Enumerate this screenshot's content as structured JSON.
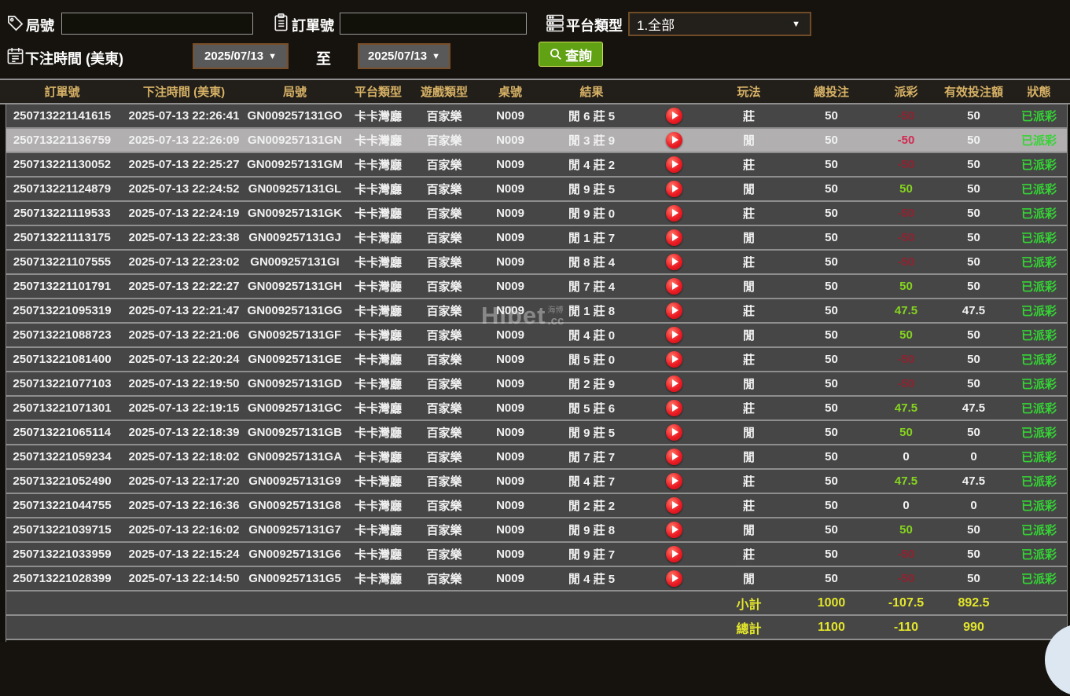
{
  "filters": {
    "round_label": "局號",
    "round_value": "",
    "order_label": "訂單號",
    "order_value": "",
    "platform_label": "平台類型",
    "platform_value": "1.全部",
    "bet_time_label": "下注時間 (美東)",
    "date_from": "2025/07/13",
    "to_label": "至",
    "date_to": "2025/07/13",
    "query_label": "查詢"
  },
  "icons": {
    "round": "tag-icon",
    "order": "clipboard-icon",
    "platform": "server-icon",
    "bet_time": "calendar-icon",
    "query": "search-icon",
    "row_action": "play-icon"
  },
  "table": {
    "columns": [
      "訂單號",
      "下注時間 (美東)",
      "局號",
      "平台類型",
      "遊戲類型",
      "桌號",
      "結果",
      "玩法",
      "總投注",
      "派彩",
      "有效投注額",
      "狀態"
    ],
    "rows": [
      {
        "order": "250713221141615",
        "time": "2025-07-13 22:26:41",
        "round": "GN009257131GO",
        "platform": "卡卡灣廳",
        "game": "百家樂",
        "table_no": "N009",
        "result": "閒 6 莊 5",
        "play": "莊",
        "total_bet": "50",
        "payout": "-50",
        "valid_bet": "50",
        "status": "已派彩",
        "highlighted": false
      },
      {
        "order": "250713221136759",
        "time": "2025-07-13 22:26:09",
        "round": "GN009257131GN",
        "platform": "卡卡灣廳",
        "game": "百家樂",
        "table_no": "N009",
        "result": "閒 3 莊 9",
        "play": "閒",
        "total_bet": "50",
        "payout": "-50",
        "valid_bet": "50",
        "status": "已派彩",
        "highlighted": true
      },
      {
        "order": "250713221130052",
        "time": "2025-07-13 22:25:27",
        "round": "GN009257131GM",
        "platform": "卡卡灣廳",
        "game": "百家樂",
        "table_no": "N009",
        "result": "閒 4 莊 2",
        "play": "莊",
        "total_bet": "50",
        "payout": "-50",
        "valid_bet": "50",
        "status": "已派彩",
        "highlighted": false
      },
      {
        "order": "250713221124879",
        "time": "2025-07-13 22:24:52",
        "round": "GN009257131GL",
        "platform": "卡卡灣廳",
        "game": "百家樂",
        "table_no": "N009",
        "result": "閒 9 莊 5",
        "play": "閒",
        "total_bet": "50",
        "payout": "50",
        "valid_bet": "50",
        "status": "已派彩",
        "highlighted": false
      },
      {
        "order": "250713221119533",
        "time": "2025-07-13 22:24:19",
        "round": "GN009257131GK",
        "platform": "卡卡灣廳",
        "game": "百家樂",
        "table_no": "N009",
        "result": "閒 9 莊 0",
        "play": "莊",
        "total_bet": "50",
        "payout": "-50",
        "valid_bet": "50",
        "status": "已派彩",
        "highlighted": false
      },
      {
        "order": "250713221113175",
        "time": "2025-07-13 22:23:38",
        "round": "GN009257131GJ",
        "platform": "卡卡灣廳",
        "game": "百家樂",
        "table_no": "N009",
        "result": "閒 1 莊 7",
        "play": "閒",
        "total_bet": "50",
        "payout": "-50",
        "valid_bet": "50",
        "status": "已派彩",
        "highlighted": false
      },
      {
        "order": "250713221107555",
        "time": "2025-07-13 22:23:02",
        "round": "GN009257131GI",
        "platform": "卡卡灣廳",
        "game": "百家樂",
        "table_no": "N009",
        "result": "閒 8 莊 4",
        "play": "莊",
        "total_bet": "50",
        "payout": "-50",
        "valid_bet": "50",
        "status": "已派彩",
        "highlighted": false
      },
      {
        "order": "250713221101791",
        "time": "2025-07-13 22:22:27",
        "round": "GN009257131GH",
        "platform": "卡卡灣廳",
        "game": "百家樂",
        "table_no": "N009",
        "result": "閒 7 莊 4",
        "play": "閒",
        "total_bet": "50",
        "payout": "50",
        "valid_bet": "50",
        "status": "已派彩",
        "highlighted": false
      },
      {
        "order": "250713221095319",
        "time": "2025-07-13 22:21:47",
        "round": "GN009257131GG",
        "platform": "卡卡灣廳",
        "game": "百家樂",
        "table_no": "N009",
        "result": "閒 1 莊 8",
        "play": "莊",
        "total_bet": "50",
        "payout": "47.5",
        "valid_bet": "47.5",
        "status": "已派彩",
        "highlighted": false
      },
      {
        "order": "250713221088723",
        "time": "2025-07-13 22:21:06",
        "round": "GN009257131GF",
        "platform": "卡卡灣廳",
        "game": "百家樂",
        "table_no": "N009",
        "result": "閒 4 莊 0",
        "play": "閒",
        "total_bet": "50",
        "payout": "50",
        "valid_bet": "50",
        "status": "已派彩",
        "highlighted": false
      },
      {
        "order": "250713221081400",
        "time": "2025-07-13 22:20:24",
        "round": "GN009257131GE",
        "platform": "卡卡灣廳",
        "game": "百家樂",
        "table_no": "N009",
        "result": "閒 5 莊 0",
        "play": "莊",
        "total_bet": "50",
        "payout": "-50",
        "valid_bet": "50",
        "status": "已派彩",
        "highlighted": false
      },
      {
        "order": "250713221077103",
        "time": "2025-07-13 22:19:50",
        "round": "GN009257131GD",
        "platform": "卡卡灣廳",
        "game": "百家樂",
        "table_no": "N009",
        "result": "閒 2 莊 9",
        "play": "閒",
        "total_bet": "50",
        "payout": "-50",
        "valid_bet": "50",
        "status": "已派彩",
        "highlighted": false
      },
      {
        "order": "250713221071301",
        "time": "2025-07-13 22:19:15",
        "round": "GN009257131GC",
        "platform": "卡卡灣廳",
        "game": "百家樂",
        "table_no": "N009",
        "result": "閒 5 莊 6",
        "play": "莊",
        "total_bet": "50",
        "payout": "47.5",
        "valid_bet": "47.5",
        "status": "已派彩",
        "highlighted": false
      },
      {
        "order": "250713221065114",
        "time": "2025-07-13 22:18:39",
        "round": "GN009257131GB",
        "platform": "卡卡灣廳",
        "game": "百家樂",
        "table_no": "N009",
        "result": "閒 9 莊 5",
        "play": "閒",
        "total_bet": "50",
        "payout": "50",
        "valid_bet": "50",
        "status": "已派彩",
        "highlighted": false
      },
      {
        "order": "250713221059234",
        "time": "2025-07-13 22:18:02",
        "round": "GN009257131GA",
        "platform": "卡卡灣廳",
        "game": "百家樂",
        "table_no": "N009",
        "result": "閒 7 莊 7",
        "play": "閒",
        "total_bet": "50",
        "payout": "0",
        "valid_bet": "0",
        "status": "已派彩",
        "highlighted": false
      },
      {
        "order": "250713221052490",
        "time": "2025-07-13 22:17:20",
        "round": "GN009257131G9",
        "platform": "卡卡灣廳",
        "game": "百家樂",
        "table_no": "N009",
        "result": "閒 4 莊 7",
        "play": "莊",
        "total_bet": "50",
        "payout": "47.5",
        "valid_bet": "47.5",
        "status": "已派彩",
        "highlighted": false
      },
      {
        "order": "250713221044755",
        "time": "2025-07-13 22:16:36",
        "round": "GN009257131G8",
        "platform": "卡卡灣廳",
        "game": "百家樂",
        "table_no": "N009",
        "result": "閒 2 莊 2",
        "play": "莊",
        "total_bet": "50",
        "payout": "0",
        "valid_bet": "0",
        "status": "已派彩",
        "highlighted": false
      },
      {
        "order": "250713221039715",
        "time": "2025-07-13 22:16:02",
        "round": "GN009257131G7",
        "platform": "卡卡灣廳",
        "game": "百家樂",
        "table_no": "N009",
        "result": "閒 9 莊 8",
        "play": "閒",
        "total_bet": "50",
        "payout": "50",
        "valid_bet": "50",
        "status": "已派彩",
        "highlighted": false
      },
      {
        "order": "250713221033959",
        "time": "2025-07-13 22:15:24",
        "round": "GN009257131G6",
        "platform": "卡卡灣廳",
        "game": "百家樂",
        "table_no": "N009",
        "result": "閒 9 莊 7",
        "play": "莊",
        "total_bet": "50",
        "payout": "-50",
        "valid_bet": "50",
        "status": "已派彩",
        "highlighted": false
      },
      {
        "order": "250713221028399",
        "time": "2025-07-13 22:14:50",
        "round": "GN009257131G5",
        "platform": "卡卡灣廳",
        "game": "百家樂",
        "table_no": "N009",
        "result": "閒 4 莊 5",
        "play": "閒",
        "total_bet": "50",
        "payout": "-50",
        "valid_bet": "50",
        "status": "已派彩",
        "highlighted": false
      }
    ],
    "subtotal": {
      "label": "小計",
      "total_bet": "1000",
      "payout": "-107.5",
      "valid_bet": "892.5"
    },
    "grand_total": {
      "label": "總計",
      "total_bet": "1100",
      "payout": "-110",
      "valid_bet": "990"
    }
  },
  "watermark": {
    "brand": "Hibet",
    "cjk": "海博",
    "suffix": ".cc"
  },
  "colors": {
    "header_text": "#d8b266",
    "row_bg": "#464646",
    "highlight_row_bg": "#b1afaf",
    "positive_green": "#85d41f",
    "negative_red": "#90222f",
    "negative_red_highlight": "#d32a52",
    "status_green": "#35d435",
    "footer_yellow": "#e3e62b",
    "query_button_green": "#61a214",
    "select_border_brown": "#7a4e28"
  }
}
